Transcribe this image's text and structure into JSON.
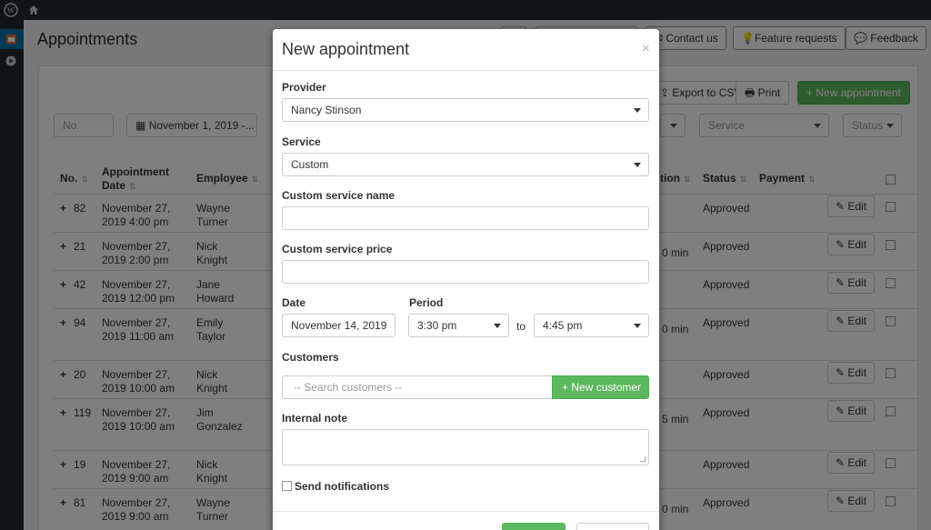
{
  "adminbar": {
    "wp_icon": "wordpress-logo-icon",
    "home_icon": "home-icon"
  },
  "page": {
    "title": "Appointments",
    "top_buttons": {
      "contact": "Contact us",
      "features": "Feature requests",
      "feedback": "Feedback"
    }
  },
  "toolbar": {
    "export": "Export to CSV",
    "print": "Print",
    "new_appointment": "New appointment"
  },
  "filters": {
    "no_placeholder": "No.",
    "date_range": "November 1, 2019 -...",
    "service": "Service",
    "status": "Status"
  },
  "table": {
    "columns": {
      "no": "No.",
      "date": "Appointment Date",
      "employee": "Employee",
      "duration": "tion",
      "status": "Status",
      "payment": "Payment"
    },
    "edit_label": "Edit",
    "rows": [
      {
        "no": "82",
        "date": "November 27, 2019 4:00 pm",
        "employee": "Wayne Turner",
        "duration": "",
        "status": "Approved"
      },
      {
        "no": "21",
        "date": "November 27, 2019 2:00 pm",
        "employee": "Nick Knight",
        "duration": "0 min",
        "status": "Approved"
      },
      {
        "no": "42",
        "date": "November 27, 2019 12:00 pm",
        "employee": "Jane Howard",
        "duration": "",
        "status": "Approved"
      },
      {
        "no": "94",
        "date": "November 27, 2019 11:00 am",
        "employee": "Emily Taylor",
        "duration": "0 min",
        "status": "Approved"
      },
      {
        "no": "20",
        "date": "November 27, 2019 10:00 am",
        "employee": "Nick Knight",
        "duration": "",
        "status": "Approved"
      },
      {
        "no": "119",
        "date": "November 27, 2019 10:00 am",
        "employee": "Jim Gonzalez",
        "duration": "5 min",
        "status": "Approved"
      },
      {
        "no": "19",
        "date": "November 27, 2019 9:00 am",
        "employee": "Nick Knight",
        "duration": "",
        "status": "Approved"
      },
      {
        "no": "81",
        "date": "November 27, 2019 9:00 am",
        "employee": "Wayne Turner",
        "duration": "0 min",
        "status": "Approved"
      }
    ]
  },
  "modal": {
    "title": "New appointment",
    "close": "×",
    "provider_label": "Provider",
    "provider_value": "Nancy Stinson",
    "service_label": "Service",
    "service_value": "Custom",
    "custom_name_label": "Custom service name",
    "custom_name_value": "",
    "custom_price_label": "Custom service price",
    "custom_price_value": "",
    "date_label": "Date",
    "date_value": "November 14, 2019",
    "period_label": "Period",
    "period_from": "3:30 pm",
    "period_to_label": "to",
    "period_to": "4:45 pm",
    "customers_label": "Customers",
    "customers_placeholder": "-- Search customers --",
    "new_customer": "New customer",
    "note_label": "Internal note",
    "note_value": "",
    "notify_label": "Send notifications"
  }
}
